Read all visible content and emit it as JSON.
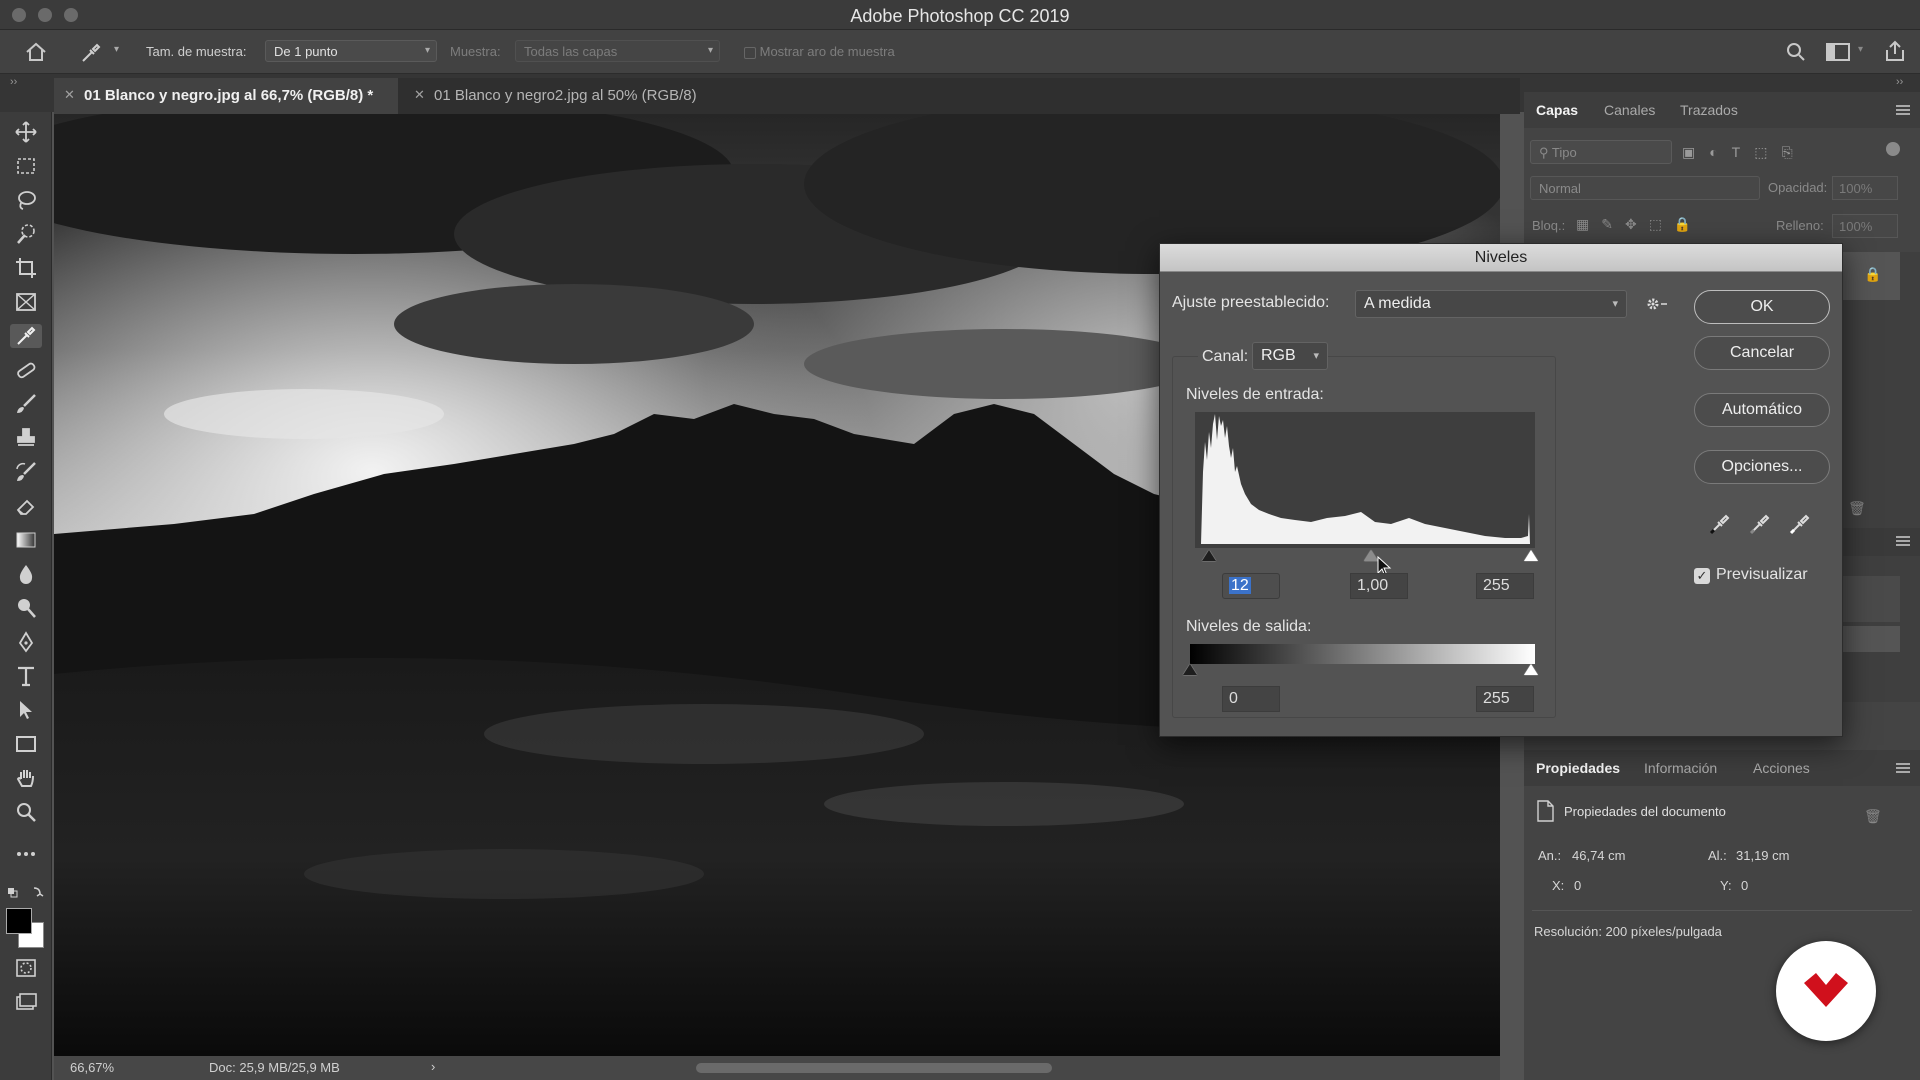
{
  "window": {
    "title": "Adobe Photoshop CC 2019"
  },
  "options_bar": {
    "sample_size_label": "Tam. de muestra:",
    "sample_size_value": "De 1 punto",
    "sample_label": "Muestra:",
    "sample_value": "Todas las capas",
    "show_ring_label": "Mostrar aro de muestra"
  },
  "tabs": [
    {
      "label": "01 Blanco y negro.jpg al 66,7% (RGB/8) *"
    },
    {
      "label": "01 Blanco y negro2.jpg al 50% (RGB/8)"
    }
  ],
  "status": {
    "zoom": "66,67%",
    "doc": "Doc: 25,9 MB/25,9 MB",
    "arrow": "›"
  },
  "layers_panel": {
    "tabs": [
      "Capas",
      "Canales",
      "Trazados"
    ],
    "filter_placeholder": "Tipo",
    "blend_mode": "Normal",
    "opacity_label": "Opacidad:",
    "opacity_value": "100%",
    "lock_label": "Bloq.:",
    "fill_label": "Relleno:",
    "fill_value": "100%"
  },
  "properties_panel": {
    "tabs": [
      "Propiedades",
      "Información",
      "Acciones"
    ],
    "title": "Propiedades del documento",
    "width_label": "An.:",
    "width_value": "46,74 cm",
    "height_label": "Al.:",
    "height_value": "31,19 cm",
    "x_label": "X:",
    "x_value": "0",
    "y_label": "Y:",
    "y_value": "0",
    "resolution": "Resolución: 200 píxeles/pulgada"
  },
  "levels_dialog": {
    "title": "Niveles",
    "preset_label": "Ajuste preestablecido:",
    "preset_value": "A medida",
    "channel_label": "Canal:",
    "channel_value": "RGB",
    "input_levels_label": "Niveles de entrada:",
    "input_black": "12",
    "input_gamma": "1,00",
    "input_white": "255",
    "output_levels_label": "Niveles de salida:",
    "output_black": "0",
    "output_white": "255",
    "buttons": {
      "ok": "OK",
      "cancel": "Cancelar",
      "auto": "Automático",
      "options": "Opciones..."
    },
    "preview_label": "Previsualizar",
    "preview_checked": true
  },
  "colors": {
    "accent": "#3b72c9",
    "logo_red": "#d0101c"
  }
}
